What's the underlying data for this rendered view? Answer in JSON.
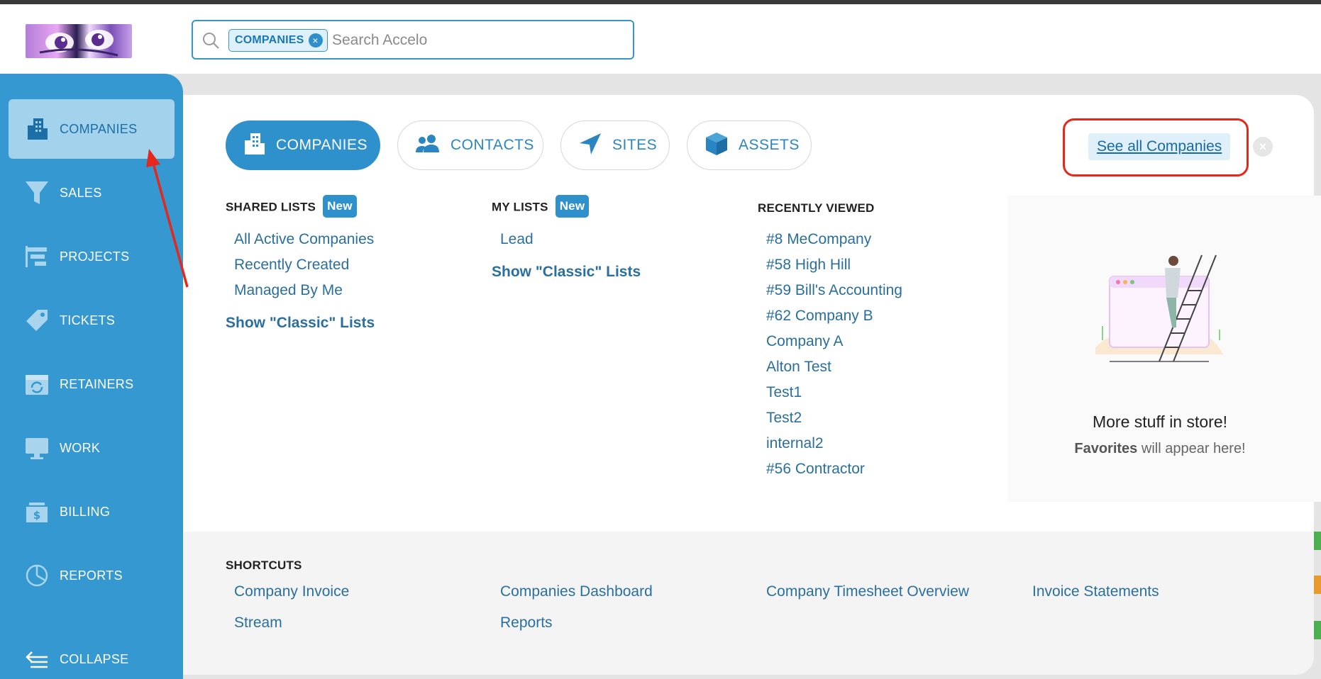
{
  "search": {
    "chip_label": "COMPANIES",
    "placeholder": "Search Accelo"
  },
  "sidebar": {
    "items": [
      {
        "label": "COMPANIES",
        "icon": "building-icon",
        "active": true
      },
      {
        "label": "SALES",
        "icon": "funnel-icon",
        "active": false
      },
      {
        "label": "PROJECTS",
        "icon": "gantt-icon",
        "active": false
      },
      {
        "label": "TICKETS",
        "icon": "tag-icon",
        "active": false
      },
      {
        "label": "RETAINERS",
        "icon": "calendar-refresh-icon",
        "active": false
      },
      {
        "label": "WORK",
        "icon": "monitor-icon",
        "active": false
      },
      {
        "label": "BILLING",
        "icon": "invoice-dollar-icon",
        "active": false
      },
      {
        "label": "REPORTS",
        "icon": "pie-chart-icon",
        "active": false
      }
    ],
    "collapse_label": "COLLAPSE"
  },
  "tabs": [
    {
      "label": "COMPANIES",
      "icon": "building-icon",
      "active": true
    },
    {
      "label": "CONTACTS",
      "icon": "people-icon",
      "active": false
    },
    {
      "label": "SITES",
      "icon": "location-arrow-icon",
      "active": false
    },
    {
      "label": "ASSETS",
      "icon": "cube-icon",
      "active": false
    }
  ],
  "see_all_label": "See all Companies",
  "shared_lists": {
    "heading": "SHARED LISTS",
    "badge": "New",
    "items": [
      "All Active Companies",
      "Recently Created",
      "Managed By Me"
    ],
    "classic": "Show \"Classic\" Lists"
  },
  "my_lists": {
    "heading": "MY LISTS",
    "badge": "New",
    "items": [
      "Lead"
    ],
    "classic": "Show \"Classic\" Lists"
  },
  "recently_viewed": {
    "heading": "RECENTLY VIEWED",
    "items": [
      "#8 MeCompany",
      "#58 High Hill",
      "#59 Bill's Accounting",
      "#62 Company B",
      "Company A",
      "Alton Test",
      "Test1",
      "Test2",
      "internal2",
      "#56 Contractor"
    ]
  },
  "favorites": {
    "title": "More stuff in store!",
    "sub_bold": "Favorites",
    "sub_rest": " will appear here!"
  },
  "shortcuts": {
    "heading": "SHORTCUTS",
    "items": [
      "Company Invoice",
      "Companies Dashboard",
      "Company Timesheet Overview",
      "Invoice Statements",
      "Stream",
      "Reports"
    ]
  },
  "colors": {
    "sidebar": "#3598d0",
    "accent": "#2f91cc",
    "highlight_box": "#e6271c",
    "arrow": "#e6271c"
  }
}
